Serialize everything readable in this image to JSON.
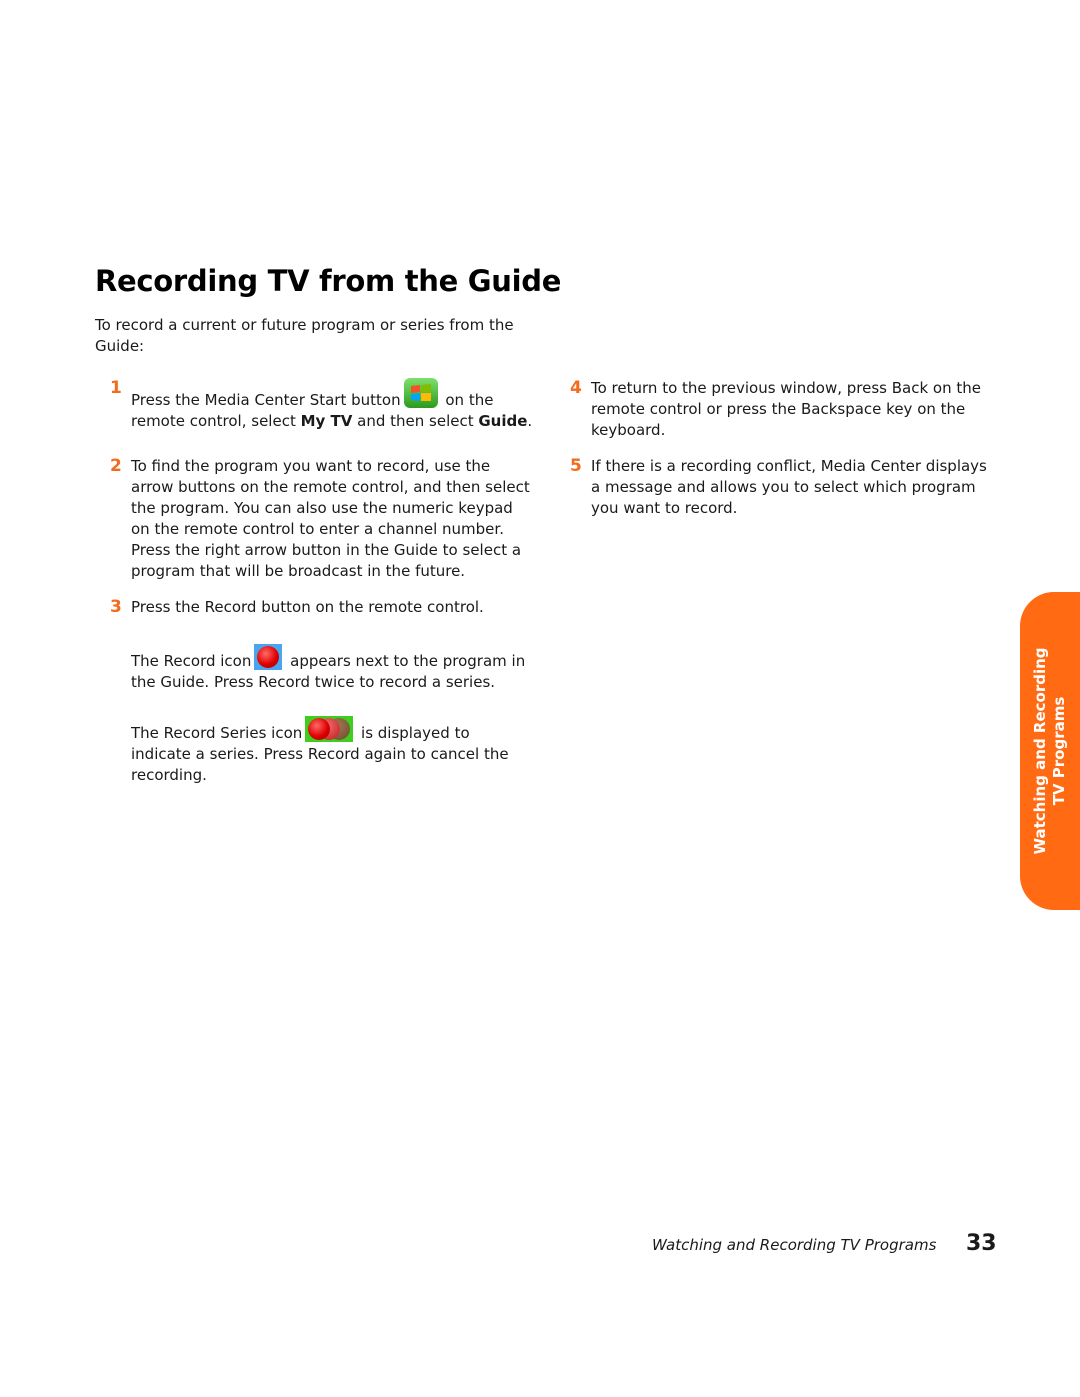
{
  "heading": "Recording TV from the Guide",
  "intro": "To record a current or future program or series from the Guide:",
  "steps": [
    {
      "num": "1",
      "text_a": "Press the Media Center Start button",
      "text_b": " on the remote control, select ",
      "bold1": "My TV",
      "text_c": " and then select ",
      "bold2": "Guide",
      "text_d": "."
    },
    {
      "num": "2",
      "text": "To find the program you want to record, use the arrow buttons on the remote control, and then select the program. You can also use the numeric keypad on the remote control to enter a channel number. Press the right arrow button in the Guide to select a program that will be broadcast in the future."
    },
    {
      "num": "3",
      "text": "Press the Record button on the remote control."
    },
    {
      "num": "4",
      "text": "To return to the previous window, press Back on the remote control or press the Backspace key on the keyboard."
    },
    {
      "num": "5",
      "text": "If there is a recording conflict, Media Center displays a message and allows you to select which program you want to record."
    }
  ],
  "record_note": {
    "before": "The Record icon",
    "after": " appears next to the program in the Guide. Press Record twice to record a series."
  },
  "series_note": {
    "before": "The Record Series icon",
    "after": " is displayed to indicate a series. Press Record again to cancel the recording."
  },
  "icons": {
    "start": "windows-start-icon",
    "record": "record-icon",
    "series": "record-series-icon"
  },
  "side_tab": {
    "line1": "Watching and Recording",
    "line2": "TV Programs"
  },
  "footer": {
    "chapter": "Watching and Recording TV Programs",
    "page": "33"
  },
  "colors": {
    "accent": "#f26c1c",
    "tab": "#ff6a13"
  }
}
